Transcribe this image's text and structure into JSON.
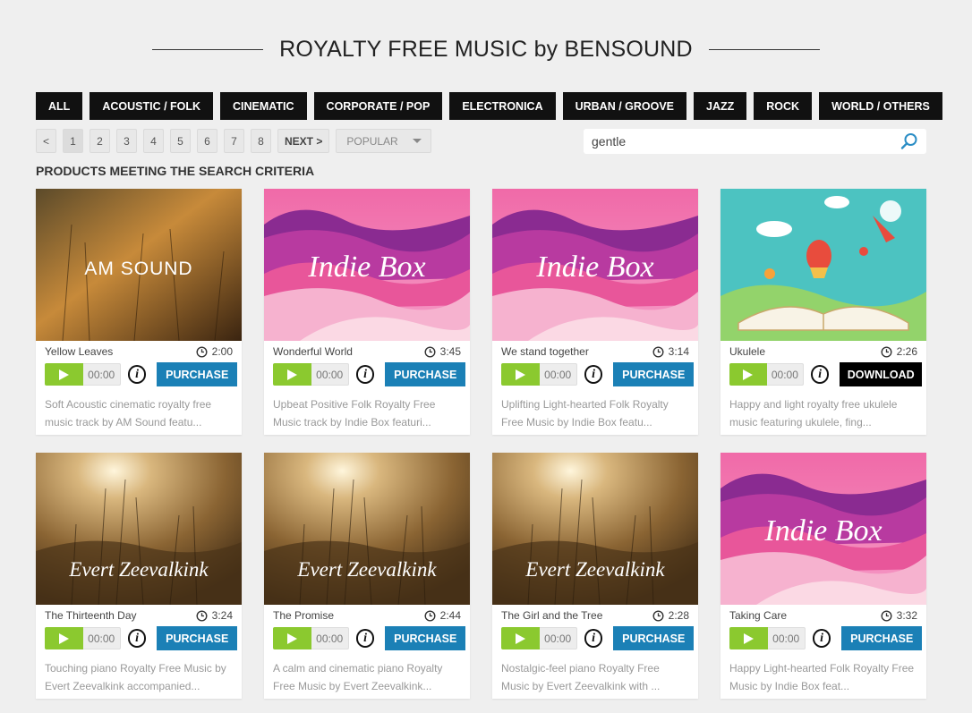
{
  "header": {
    "title": "ROYALTY FREE MUSIC by BENSOUND"
  },
  "categories": [
    "ALL",
    "ACOUSTIC / FOLK",
    "CINEMATIC",
    "CORPORATE / POP",
    "ELECTRONICA",
    "URBAN / GROOVE",
    "JAZZ",
    "ROCK",
    "WORLD / OTHERS"
  ],
  "pager": {
    "prev": "<",
    "pages": [
      "1",
      "2",
      "3",
      "4",
      "5",
      "6",
      "7",
      "8"
    ],
    "current": "1",
    "next": "NEXT >",
    "sort": "POPULAR"
  },
  "search": {
    "value": "gentle"
  },
  "section_title": "PRODUCTS MEETING THE SEARCH CRITERIA",
  "tracks": [
    {
      "title": "Yellow Leaves",
      "duration": "2:00",
      "time": "00:00",
      "action": "PURCHASE",
      "desc1": "Soft Acoustic cinematic royalty free",
      "desc2": "music track by AM Sound featu...",
      "art_text": "AM SOUND",
      "art": "field"
    },
    {
      "title": "Wonderful World",
      "duration": "3:45",
      "time": "00:00",
      "action": "PURCHASE",
      "desc1": "Upbeat Positive Folk Royalty Free",
      "desc2": "Music track by Indie Box featuri...",
      "art_text": "Indie Box",
      "art": "mountains"
    },
    {
      "title": "We stand together",
      "duration": "3:14",
      "time": "00:00",
      "action": "PURCHASE",
      "desc1": "Uplifting Light-hearted Folk Royalty",
      "desc2": "Free Music by Indie Box featu...",
      "art_text": "Indie Box",
      "art": "mountains"
    },
    {
      "title": "Ukulele",
      "duration": "2:26",
      "time": "00:00",
      "action": "DOWNLOAD",
      "desc1": "Happy and light royalty free ukulele",
      "desc2": "music featuring ukulele, fing...",
      "art_text": "",
      "art": "book"
    },
    {
      "title": "The Thirteenth Day",
      "duration": "3:24",
      "time": "00:00",
      "action": "PURCHASE",
      "desc1": "Touching piano Royalty Free Music by",
      "desc2": "Evert Zeevalkink accompanied...",
      "art_text": "Evert Zeevalkink",
      "art": "grass"
    },
    {
      "title": "The Promise",
      "duration": "2:44",
      "time": "00:00",
      "action": "PURCHASE",
      "desc1": "A calm and cinematic piano Royalty",
      "desc2": "Free Music by Evert Zeevalkink...",
      "art_text": "Evert Zeevalkink",
      "art": "grass"
    },
    {
      "title": "The Girl and the Tree",
      "duration": "2:28",
      "time": "00:00",
      "action": "PURCHASE",
      "desc1": "Nostalgic-feel piano Royalty Free",
      "desc2": "Music by Evert Zeevalkink with ...",
      "art_text": "Evert Zeevalkink",
      "art": "grass"
    },
    {
      "title": "Taking Care",
      "duration": "3:32",
      "time": "00:00",
      "action": "PURCHASE",
      "desc1": "Happy Light-hearted Folk Royalty Free",
      "desc2": "Music by Indie Box feat...",
      "art_text": "Indie Box",
      "art": "mountains"
    }
  ]
}
